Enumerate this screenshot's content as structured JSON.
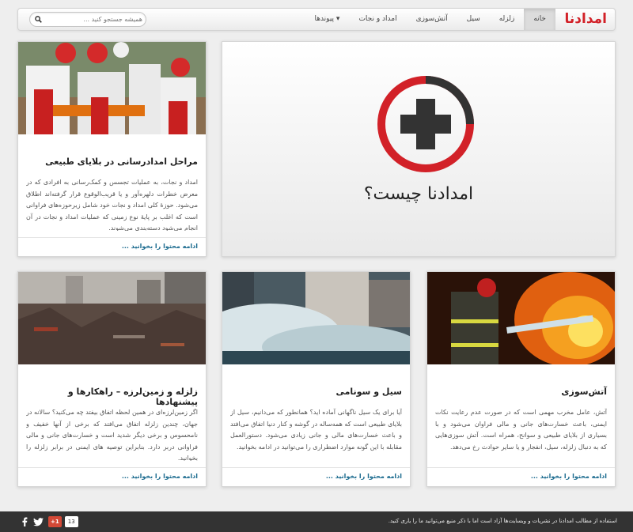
{
  "brand": "امدادنا",
  "nav": {
    "items": [
      {
        "label": "خانه"
      },
      {
        "label": "زلزله"
      },
      {
        "label": "سیل"
      },
      {
        "label": "آتش‌سوزی"
      },
      {
        "label": "امداد و نجات"
      },
      {
        "label": "پیوندها ▾"
      }
    ],
    "search_placeholder": "همیشه جستجو کنید ..."
  },
  "hero": {
    "title": "امدادنا چیست؟",
    "colors": {
      "ring_red": "#d22128",
      "ring_dark": "#333333",
      "cross": "#333333"
    }
  },
  "cards": [
    {
      "title": "مراحل امدادرسانی در بلایای طبیعی",
      "text": "امداد و نجات، به عملیات تجسس و کمک‌رسانی به افرادی که در معرض خطرات دلهره‌آور و یا قریب‌الوقوع قرار گرفته‌اند اطلاق می‌شود. حوزهٔ کلی امداد و نجات خود شامل زیرحوزه‌های فراوانی است که اغلب بر پایهٔ نوع زمینی که عملیات امداد و نجات در آن انجام می‌شود دسته‌بندی می‌شوند.",
      "more": "ادامه محتوا را بخوانید ..."
    },
    {
      "title": "آتش‌سوزی",
      "text": "آتش، عامل مخرب مهمی است که در صورت عدم رعایت نکات ایمنی، باعث خسارت‌های جانی و مالی فراوان می‌شود و با بسیاری از بلایای طبیعی و سوانح، همراه است. آتش سوزی‌هایی که به دنبال زلزله، سیل، انفجار و یا سایر حوادث رخ می‌دهد.",
      "more": "ادامه محتوا را بخوانید ..."
    },
    {
      "title": "سیل و سونامی",
      "text": "آیا برای یک سیل ناگهانی آماده اید؟ همانطور که می‌دانیم، سیل از بلایای طبیعی است که همه‌ساله در گوشه و کنار دنیا اتفاق می‌افتد و باعث خسارت‌های مالی و جانی زیادی می‌شود. دستورالعمل مقابله با این گونه موارد اضطراری را می‌توانید در ادامه بخوانید.",
      "more": "ادامه محتوا را بخوانید ..."
    },
    {
      "title": "زلزله و زمین‌لرزه – راهکارها و پیشنهادها",
      "text": "اگر زمین‌لرزه‌ای در همین لحظه اتفاق بیفتد چه می‌کنید؟ سالانه در جهان، چندین زلزله اتفاق می‌افتد که برخی از آنها خفیف و نامحسوس و برخی دیگر شدید است و خسارت‌های جانی و مالی فراوانی دربر دارد. بنابراین توصیه های ایمنی در برابر زلزله را بخوانید.",
      "more": "ادامه محتوا را بخوانید ..."
    }
  ],
  "footer": {
    "copyright": "استفاده از مطالب امدادنا در نشریات و وبسایت‌ها آزاد است اما با ذکر منبع می‌توانید ما را یاری کنید.",
    "gplus_label": "+1",
    "gplus_count": "13"
  }
}
